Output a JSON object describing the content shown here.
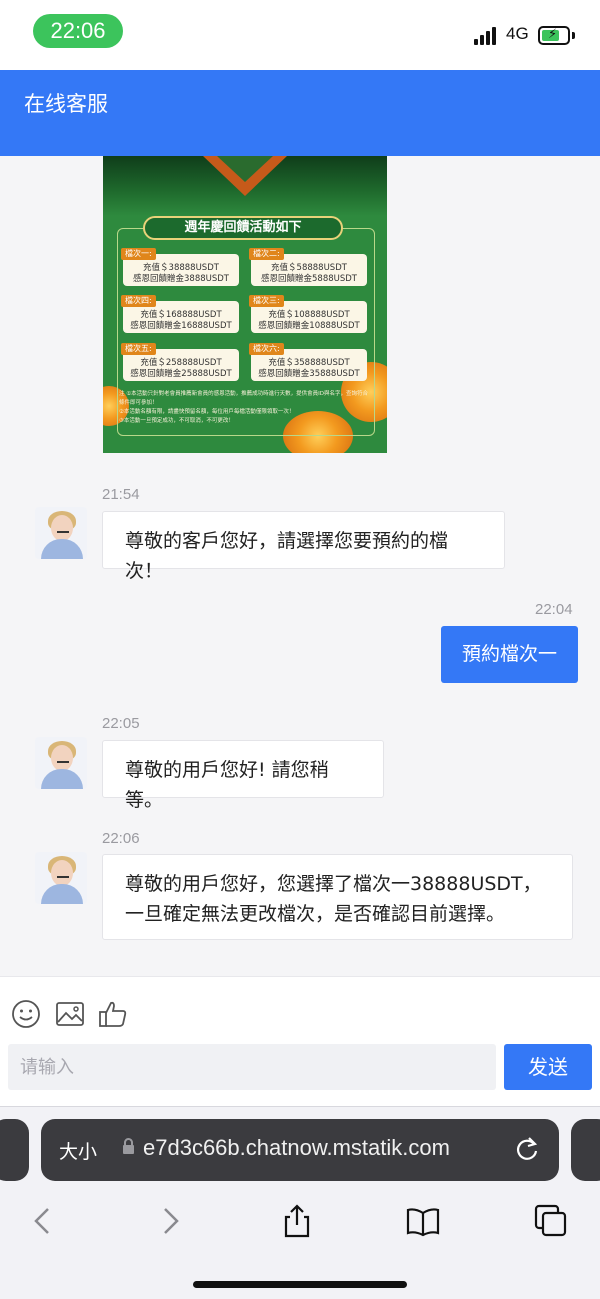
{
  "status_bar": {
    "time": "22:06",
    "network": "4G"
  },
  "header": {
    "title": "在线客服"
  },
  "promo": {
    "title": "週年慶回饋活動如下",
    "tiers": [
      {
        "tag": "檔次一:",
        "line1": "充值＄38888USDT",
        "line2": "感恩回饋贈金3888USDT"
      },
      {
        "tag": "檔次二:",
        "line1": "充值＄58888USDT",
        "line2": "感恩回饋贈金5888USDT"
      },
      {
        "tag": "檔次四:",
        "line1": "充值＄168888USDT",
        "line2": "感恩回饋贈金16888USDT"
      },
      {
        "tag": "檔次三:",
        "line1": "充值＄108888USDT",
        "line2": "感恩回饋贈金10888USDT"
      },
      {
        "tag": "檔次五:",
        "line1": "充值＄258888USDT",
        "line2": "感恩回饋贈金25888USDT"
      },
      {
        "tag": "檔次六:",
        "line1": "充值＄358888USDT",
        "line2": "感恩回饋贈金35888USDT"
      }
    ],
    "notes": [
      "注 ①本活動只針對老會員推薦新會員的感恩活動，推薦成功時進行天數，提供會員ID與名字，查詢符合條件即可參加！",
      "②本活動名額有限，請盡快預留名額，每位用戶每檔活動僅限領取一次！",
      "③本活動一旦預定成功，不可取消，不可更改！"
    ]
  },
  "messages": [
    {
      "time": "21:54",
      "text": "尊敬的客戶您好，請選擇您要預約的檔次！"
    },
    {
      "time": "22:04",
      "text": "預約檔次一"
    },
    {
      "time": "22:05",
      "text": "尊敬的用戶您好! 請您稍等。"
    },
    {
      "time": "22:06",
      "text": "尊敬的用戶您好，您選擇了檔次一38888USDT，一旦確定無法更改檔次，是否確認目前選擇。"
    }
  ],
  "input": {
    "placeholder": "请输入",
    "send_label": "发送"
  },
  "browser": {
    "text_size_label": "大小",
    "url": "e7d3c66b.chatnow.mstatik.com"
  }
}
